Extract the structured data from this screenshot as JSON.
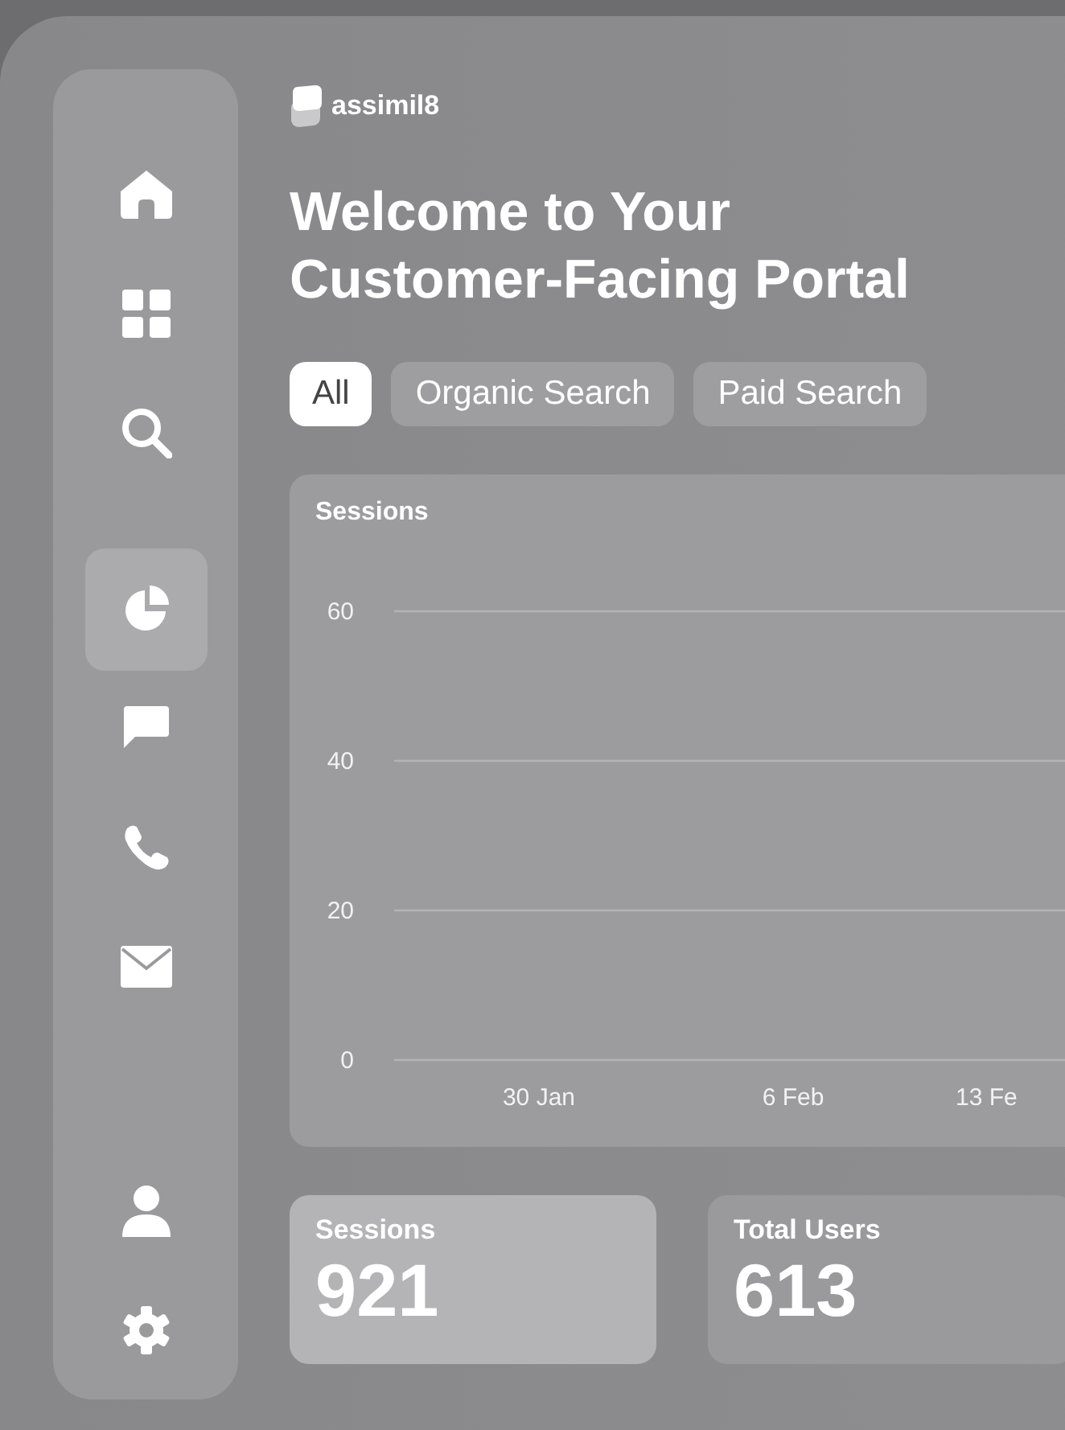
{
  "brand": {
    "name": "assimil8"
  },
  "sidebar": {
    "items": [
      {
        "selected": false
      },
      {
        "selected": false
      },
      {
        "selected": false
      },
      {
        "selected": true
      },
      {
        "selected": false
      },
      {
        "selected": false
      },
      {
        "selected": false
      },
      {
        "selected": false
      },
      {
        "selected": false
      }
    ]
  },
  "title": "Welcome to Your Customer-Facing Portal",
  "filters": [
    {
      "label": "All",
      "selected": true
    },
    {
      "label": "Organic Search",
      "selected": false
    },
    {
      "label": "Paid Search",
      "selected": false
    }
  ],
  "chart": {
    "chart_data": {
      "type": "line",
      "title": "Sessions",
      "categories": [
        "30 Jan",
        "6 Feb",
        "13 Fe"
      ],
      "ylim": [
        0,
        60
      ],
      "yticks": [
        0,
        20,
        40,
        60
      ]
    }
  },
  "stats": [
    {
      "label": "Sessions",
      "value": "921",
      "selected": true
    },
    {
      "label": "Total Users",
      "value": "613",
      "selected": false
    }
  ]
}
